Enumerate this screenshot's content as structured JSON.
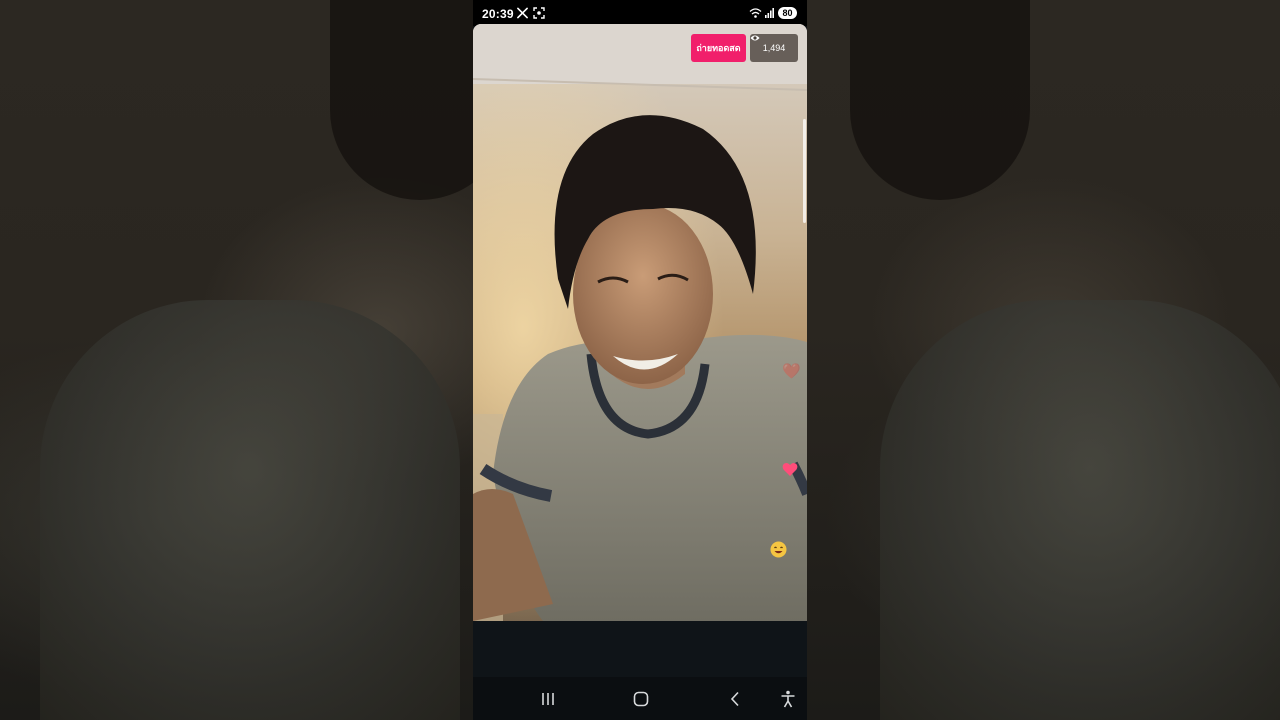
{
  "status_bar": {
    "time": "20:39",
    "battery": "80",
    "icons": [
      "x-app-icon",
      "screen-capture-icon",
      "wifi-icon",
      "signal-icon",
      "battery-icon"
    ]
  },
  "live_stream": {
    "live_badge": "ถ่ายทอดสด",
    "viewer_count": "1,494",
    "reactions": [
      "heart-icon",
      "heart-icon",
      "smiley-emoji"
    ],
    "colors": {
      "live_badge": "#f11f6b",
      "viewer_badge": "#463e37"
    }
  },
  "navigation_bar": {
    "buttons": [
      "recents-icon",
      "home-icon",
      "back-icon",
      "accessibility-icon"
    ]
  }
}
